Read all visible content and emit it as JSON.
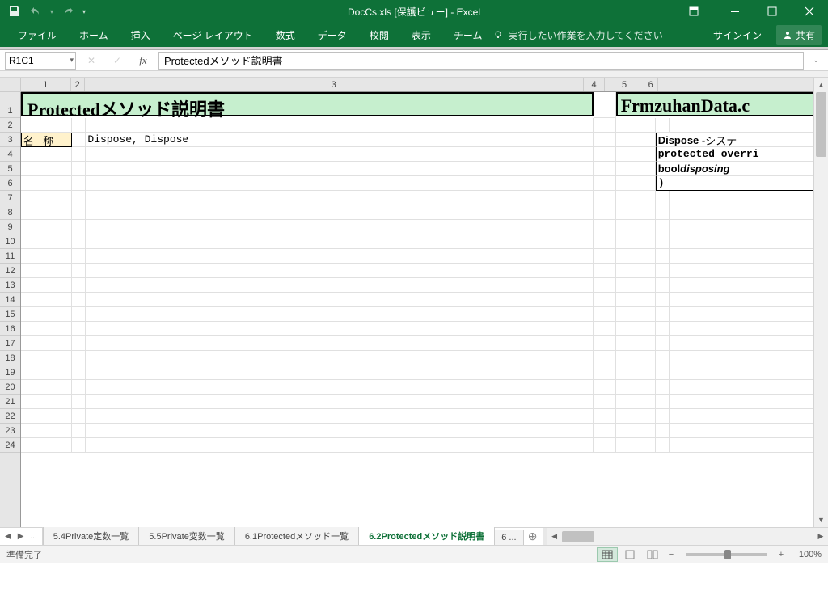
{
  "title_bar": {
    "filename": "DocCs.xls",
    "mode": "[保護ビュー]",
    "app": "Excel",
    "full": "DocCs.xls  [保護ビュー] - Excel"
  },
  "ribbon": {
    "tabs": [
      "ファイル",
      "ホーム",
      "挿入",
      "ページ レイアウト",
      "数式",
      "データ",
      "校閲",
      "表示",
      "チーム"
    ],
    "tell_me": "実行したい作業を入力してください",
    "signin": "サインイン",
    "share": "共有"
  },
  "formula_bar": {
    "name_box": "R1C1",
    "formula": "Protectedメソッド説明書"
  },
  "columns": [
    "1",
    "2",
    "3",
    "4",
    "5",
    "6"
  ],
  "rows_visible": 24,
  "sheet": {
    "title1": "Protectedメソッド説明書",
    "title2": "FrmzuhanData.c",
    "label_name": "名 称",
    "dispose": "Dispose, Dispose",
    "code": {
      "l1_a": "Dispose - ",
      "l1_b": "システ",
      "l2": "protected overri",
      "l3_a": "  bool ",
      "l3_b": "disposing",
      "l4": ")"
    }
  },
  "sheet_tabs": {
    "items": [
      "5.4Private定数一覧",
      "5.5Private変数一覧",
      "6.1Protectedメソッド一覧",
      "6.2Protectedメソッド説明書"
    ],
    "more_left": "...",
    "more_right": "6 ...",
    "active_index": 3
  },
  "status": {
    "ready": "準備完了",
    "zoom": "100%"
  }
}
